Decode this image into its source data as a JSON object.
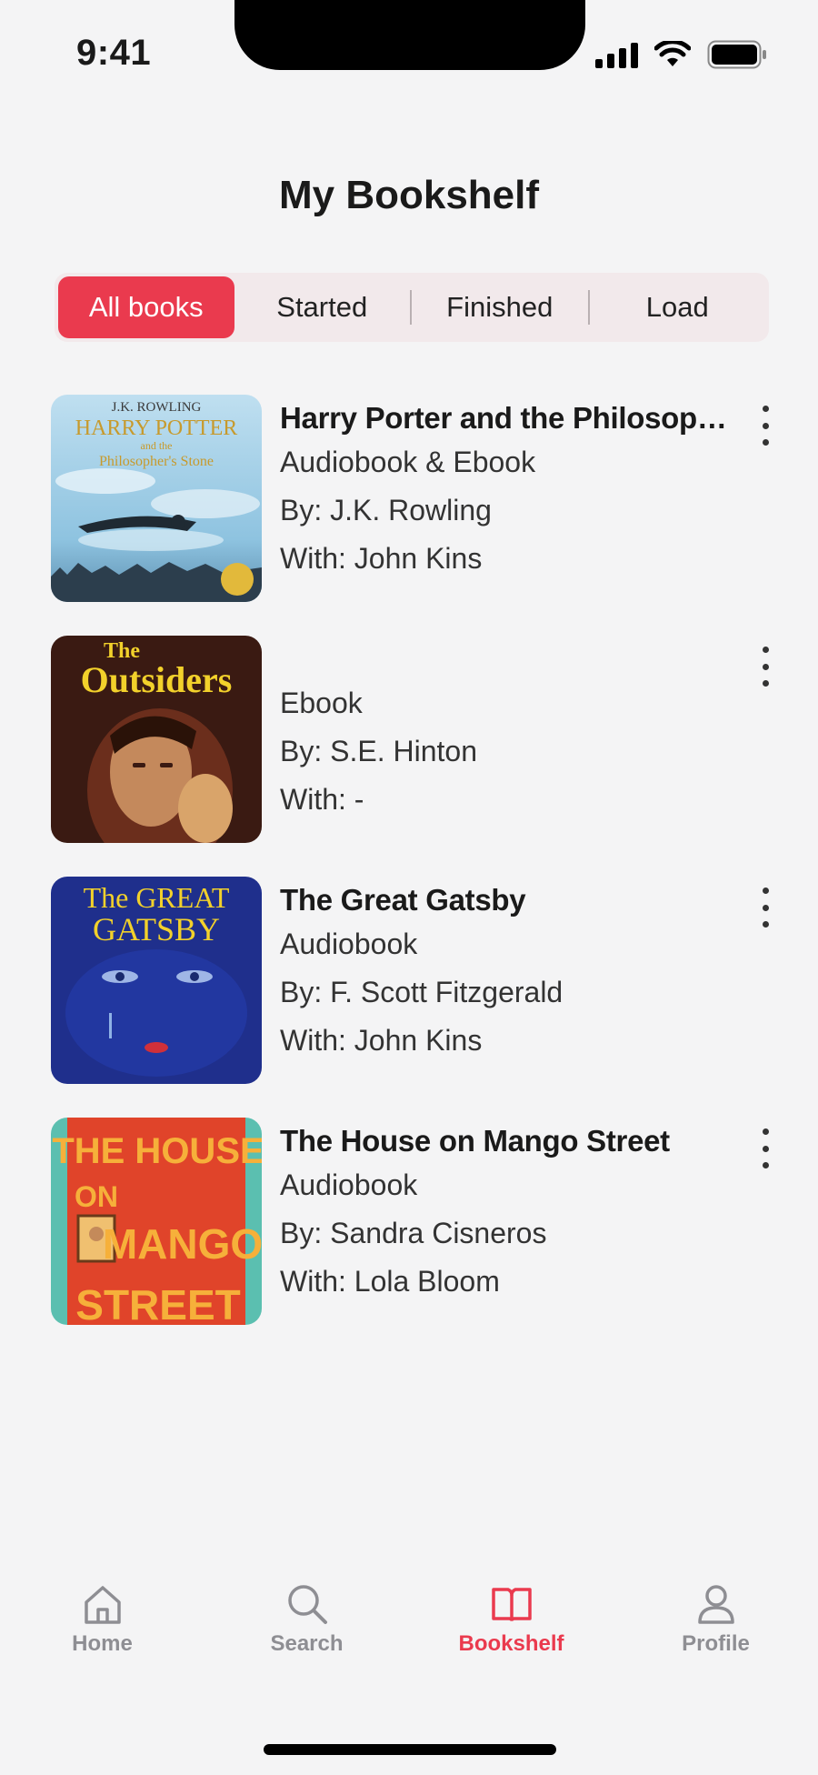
{
  "status_bar": {
    "time": "9:41"
  },
  "page": {
    "title": "My Bookshelf"
  },
  "filters": [
    "All books",
    "Started",
    "Finished",
    "Load"
  ],
  "books": [
    {
      "title": "Harry Porter and the Philosophe...",
      "format": "Audiobook & Ebook",
      "author": "By:  J.K. Rowling",
      "narrator": "With: John Kins",
      "cover_text": {
        "author": "J.K. ROWLING",
        "title": "HARRY POTTER",
        "and": "and the",
        "subtitle": "Philosopher's Stone"
      }
    },
    {
      "title": "",
      "format": "Ebook",
      "author": "By:  S.E. Hinton",
      "narrator": "With: -",
      "cover_text": {
        "small": "The",
        "title": "Outsiders"
      }
    },
    {
      "title": "The Great Gatsby",
      "format": "Audiobook",
      "author": "By:  F. Scott Fitzgerald",
      "narrator": "With: John Kins",
      "cover_text": {
        "line1": "The GREAT",
        "line2": "GATSBY"
      }
    },
    {
      "title": "The House on Mango Street",
      "format": "Audiobook",
      "author": "By:  Sandra Cisneros",
      "narrator": "With: Lola Bloom",
      "cover_text": {
        "line1": "THE HOUSE",
        "line2": "ON",
        "line3": "MANGO",
        "line4": "STREET"
      }
    }
  ],
  "tabbar": [
    {
      "label": "Home",
      "icon": "home-icon"
    },
    {
      "label": "Search",
      "icon": "search-icon"
    },
    {
      "label": "Bookshelf",
      "icon": "book-icon"
    },
    {
      "label": "Profile",
      "icon": "person-icon"
    }
  ],
  "colors": {
    "accent": "#ea3a4e",
    "background": "#f4f4f5",
    "segment_bg": "#f2e9eb",
    "inactive_tab": "#8e8e93"
  }
}
